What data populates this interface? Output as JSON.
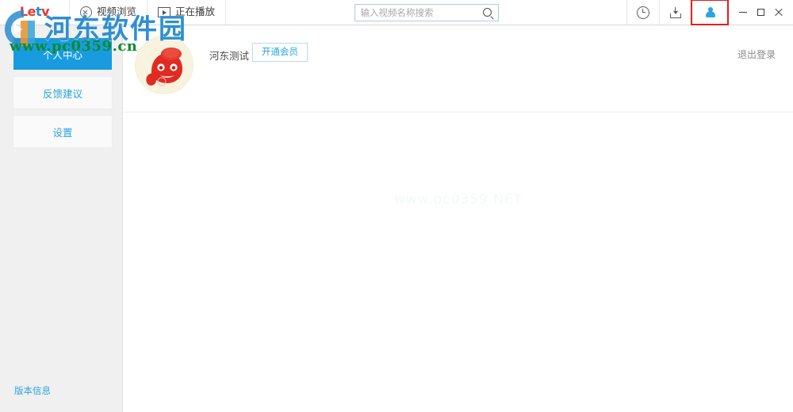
{
  "app": {
    "brand": "Letv",
    "brand_parts": [
      "Le",
      "t",
      "v"
    ]
  },
  "header": {
    "nav": [
      {
        "label": "视频浏览",
        "icon": "circle-x-icon"
      },
      {
        "label": "正在播放",
        "icon": "play-box-icon"
      }
    ],
    "search": {
      "placeholder": "输入视频名称搜索",
      "value": "",
      "button_icon": "search-icon"
    },
    "tools": [
      {
        "name": "history-clock-icon",
        "highlighted": false
      },
      {
        "name": "download-icon",
        "highlighted": false
      },
      {
        "name": "user-account-icon",
        "highlighted": true
      }
    ],
    "window_controls": [
      {
        "name": "minimize",
        "glyph": "—"
      },
      {
        "name": "maximize",
        "glyph": "▢"
      },
      {
        "name": "close",
        "glyph": "✕"
      }
    ],
    "highlight_color": "#f01a10"
  },
  "sidebar": {
    "items": [
      {
        "label": "个人中心",
        "active": true
      },
      {
        "label": "反馈建议",
        "active": false
      },
      {
        "label": "设置",
        "active": false
      }
    ],
    "version_info": "版本信息",
    "active_color": "#189cdf",
    "link_color": "#2aa3dd"
  },
  "main": {
    "profile": {
      "avatar_alt": "user-avatar",
      "username": "河东测试",
      "vip_button": "开通会员",
      "logout": "退出登录"
    },
    "center_watermark": "www.pc0359.NET"
  },
  "watermark": {
    "title": "河东软件园",
    "url": "www.pc0359.cn",
    "title_color": "#2f8fd0",
    "url_color": "#0f8a2f"
  }
}
